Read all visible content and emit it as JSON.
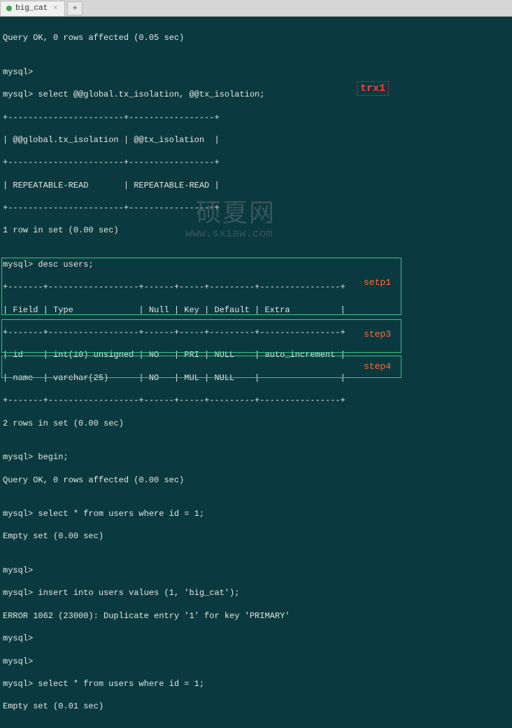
{
  "tab": {
    "title": "big_cat"
  },
  "label_trx": "trx1",
  "watermark": {
    "line1": "硕夏网",
    "line2": "www.sxiaw.com"
  },
  "terminal": {
    "l0": "Query OK, 0 rows affected (0.05 sec)",
    "l1": "",
    "l2": "mysql>",
    "l3": "mysql> select @@global.tx_isolation, @@tx_isolation;",
    "l4": "+-----------------------+-----------------+",
    "l5": "| @@global.tx_isolation | @@tx_isolation  |",
    "l6": "+-----------------------+-----------------+",
    "l7": "| REPEATABLE-READ       | REPEATABLE-READ |",
    "l8": "+-----------------------+-----------------+",
    "l9": "1 row in set (0.00 sec)",
    "l10": "",
    "l11": "mysql> desc users;",
    "l12": "+-------+------------------+------+-----+---------+----------------+",
    "l13": "| Field | Type             | Null | Key | Default | Extra          |",
    "l14": "+-------+------------------+------+-----+---------+----------------+",
    "l15": "| id    | int(10) unsigned | NO   | PRI | NULL    | auto_increment |",
    "l16": "| name  | varchar(25)      | NO   | MUL | NULL    |                |",
    "l17": "+-------+------------------+------+-----+---------+----------------+",
    "l18": "2 rows in set (0.00 sec)",
    "l19": "",
    "l20": "mysql> begin;",
    "l21": "Query OK, 0 rows affected (0.00 sec)",
    "l22": "",
    "l23": "mysql> select * from users where id = 1;",
    "l24": "Empty set (0.00 sec)",
    "l25": "",
    "l26": "mysql>",
    "l27": "mysql> insert into users values (1, 'big_cat');",
    "l28": "ERROR 1062 (23000): Duplicate entry '1' for key 'PRIMARY'",
    "l29": "mysql>",
    "l30": "mysql>",
    "l31": "mysql> select * from users where id = 1;",
    "l32": "Empty set (0.01 sec)"
  },
  "boxes": {
    "step1": {
      "label": "setp1"
    },
    "step3": {
      "label": "step3"
    },
    "step4": {
      "label": "step4"
    }
  }
}
